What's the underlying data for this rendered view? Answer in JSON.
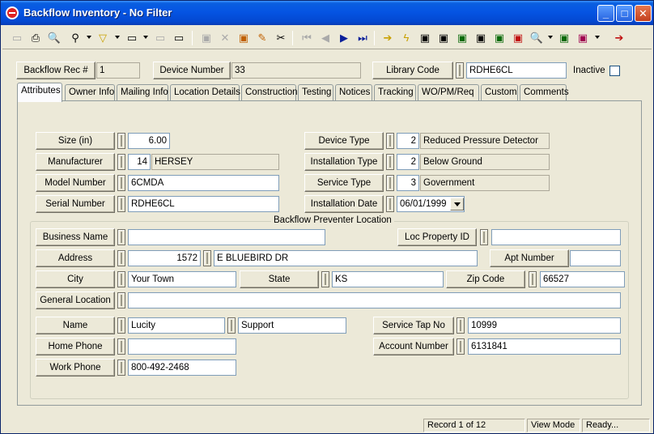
{
  "window": {
    "title": "Backflow Inventory - No Filter"
  },
  "title_buttons": {
    "minimize": "_",
    "maximize": "□",
    "close": "✕"
  },
  "toolbar_icons": {
    "new": "▭",
    "print": "⎙",
    "preview": "🔍",
    "filter": "▽",
    "lookup": "⚲",
    "first": "⏮",
    "prev": "◀",
    "next": "▶",
    "last": "⏭",
    "go": "➔",
    "flash": "ϟ",
    "edit": "✎",
    "cut": "✂",
    "delete": "✕",
    "save": "▣"
  },
  "header": {
    "rec_label": "Backflow Rec #",
    "rec_value": "1",
    "device_number_label": "Device Number",
    "device_number_value": "33",
    "library_code_label": "Library Code",
    "library_code_value": "RDHE6CL",
    "inactive_label": "Inactive"
  },
  "tabs": [
    {
      "label": "Attributes"
    },
    {
      "label": "Owner Info"
    },
    {
      "label": "Mailing Info"
    },
    {
      "label": "Location Details"
    },
    {
      "label": "Construction"
    },
    {
      "label": "Testing"
    },
    {
      "label": "Notices"
    },
    {
      "label": "Tracking"
    },
    {
      "label": "WO/PM/Req"
    },
    {
      "label": "Custom"
    },
    {
      "label": "Comments"
    }
  ],
  "attributes": {
    "size_label": "Size (in)",
    "size_value": "6.00",
    "manufacturer_label": "Manufacturer",
    "manufacturer_code": "14",
    "manufacturer_name": "HERSEY",
    "model_label": "Model Number",
    "model_value": "6CMDA",
    "serial_label": "Serial Number",
    "serial_value": "RDHE6CL",
    "device_type_label": "Device Type",
    "device_type_code": "2",
    "device_type_name": "Reduced Pressure Detector",
    "installation_type_label": "Installation Type",
    "installation_type_code": "2",
    "installation_type_name": "Below Ground",
    "service_type_label": "Service Type",
    "service_type_code": "3",
    "service_type_name": "Government",
    "installation_date_label": "Installation Date",
    "installation_date_value": "06/01/1999"
  },
  "location": {
    "group_title": "Backflow Preventer Location",
    "business_name_label": "Business Name",
    "business_name_value": "",
    "loc_property_label": "Loc Property ID",
    "loc_property_value": "",
    "address_label": "Address",
    "address_number": "1572",
    "address_street": "E BLUEBIRD DR",
    "apt_label": "Apt Number",
    "apt_value": "",
    "city_label": "City",
    "city_value": "Your Town",
    "state_label": "State",
    "state_value": "KS",
    "zip_label": "Zip Code",
    "zip_value": "66527",
    "general_location_label": "General Location",
    "general_location_value": "",
    "name_label": "Name",
    "name_first": "Lucity",
    "name_second": "Support",
    "service_tap_label": "Service Tap No",
    "service_tap_value": "10999",
    "home_phone_label": "Home Phone",
    "home_phone_value": "",
    "account_number_label": "Account Number",
    "account_number_value": "6131841",
    "work_phone_label": "Work Phone",
    "work_phone_value": "800-492-2468"
  },
  "status": {
    "record": "Record 1 of 12",
    "mode": "View Mode",
    "state": "Ready..."
  }
}
